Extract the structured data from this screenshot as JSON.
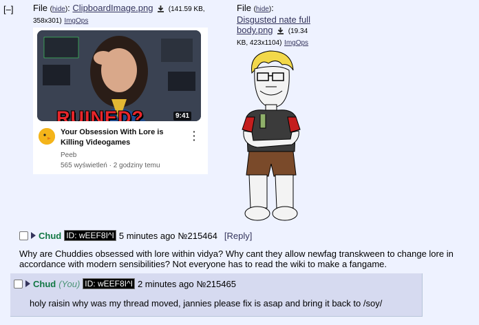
{
  "collapse_label": "[–]",
  "file1": {
    "label": "File",
    "hide": "hide",
    "filename": "ClipboardImage.png",
    "size": "(141.59 KB, 358x301)",
    "imgops": "ImgOps",
    "thumbnail": {
      "overlay_text": "RUINED?",
      "duration": "9:41",
      "video_title": "Your Obsession With Lore is Killing Videogames",
      "channel": "Peeb",
      "meta": "565 wyświetleń · 2 godziny temu"
    }
  },
  "file2": {
    "label": "File",
    "hide": "hide",
    "filename_line1": "Disgusted nate full",
    "filename_line2": "body.png",
    "size_line1": "(19.34",
    "size_line2": "KB, 423x1104)",
    "imgops": "ImgOps"
  },
  "post1": {
    "name": "Chud",
    "id": "ID: wEEF8I^I",
    "time": "5 minutes ago",
    "number": "№215464",
    "reply": "[Reply]",
    "body": "Why are Chuddies obsessed with lore within vidya? Why cant they allow newfag transkween to change lore  in accordance with modern sensibilities? Not everyone has to read the wiki to make a fangame."
  },
  "post2": {
    "name": "Chud",
    "you": "(You)",
    "id": "ID: wEEF8I^I",
    "time": "2 minutes ago",
    "number": "№215465",
    "body": "holy raisin why was my thread moved, jannies please fix is asap and bring it back to /soy/"
  },
  "colors": {
    "background": "#eef2ff",
    "reply_bg": "#d6daf0",
    "name": "#117743",
    "link": "#34345c"
  }
}
